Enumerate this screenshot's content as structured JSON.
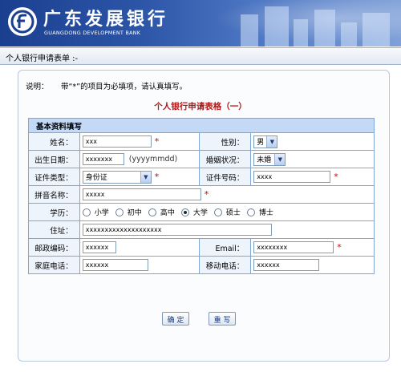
{
  "bank": {
    "name_cn": "广东发展银行",
    "name_en": "GUANGDONG DEVELOPMENT BANK"
  },
  "breadcrumb": "个人银行申请表单 :-",
  "note": {
    "label": "说明：",
    "text": "带“*”的项目为必填项，请认真填写。"
  },
  "form_title": "个人银行申请表格（一）",
  "section_title": "基本资料填写",
  "fields": {
    "name": {
      "label": "姓名：",
      "value": "xxx",
      "required": "*"
    },
    "gender": {
      "label": "性别：",
      "value": "男"
    },
    "birthdate": {
      "label": "出生日期：",
      "value": "xxxxxxx",
      "hint": "(yyyymmdd)"
    },
    "marital": {
      "label": "婚姻状况：",
      "value": "未婚"
    },
    "id_type": {
      "label": "证件类型：",
      "value": "身份证",
      "required": "*"
    },
    "id_number": {
      "label": "证件号码：",
      "value": "xxxx",
      "required": "*"
    },
    "pinyin": {
      "label": "拼音名称：",
      "value": "xxxxx",
      "required": "*"
    },
    "education": {
      "label": "学历：",
      "options": [
        "小学",
        "初中",
        "高中",
        "大学",
        "硕士",
        "博士"
      ],
      "selected": "大学"
    },
    "address": {
      "label": "住址：",
      "value": "xxxxxxxxxxxxxxxxxxxx"
    },
    "postcode": {
      "label": "邮政编码：",
      "value": "xxxxxx"
    },
    "email": {
      "label": "Email：",
      "value": "xxxxxxxx",
      "required": "*"
    },
    "home_phone": {
      "label": "家庭电话：",
      "value": "xxxxxx"
    },
    "mobile": {
      "label": "移动电话：",
      "value": "xxxxxx"
    }
  },
  "buttons": {
    "confirm": "确 定",
    "reset": "重 写"
  },
  "colors": {
    "banner": "#2c55a8",
    "table_border": "#7fa6d9",
    "section_header": "#c3d9f5",
    "title_red": "#b21616",
    "required_star": "#d40000"
  }
}
